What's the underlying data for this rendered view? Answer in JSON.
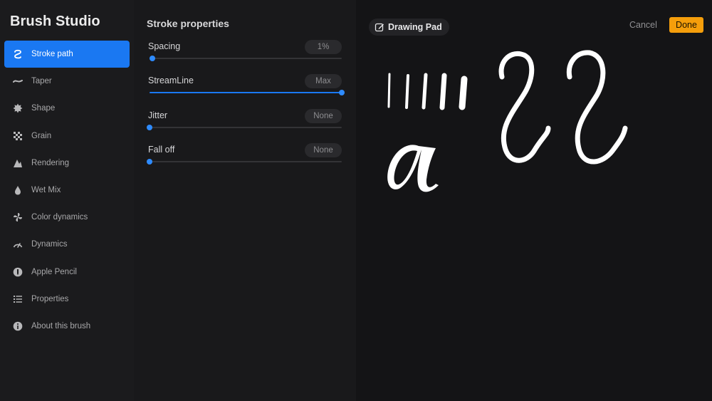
{
  "app": {
    "title": "Brush Studio"
  },
  "sidebar": {
    "items": [
      {
        "label": "Stroke path",
        "icon": "stroke-path-icon",
        "active": true
      },
      {
        "label": "Taper",
        "icon": "taper-icon"
      },
      {
        "label": "Shape",
        "icon": "shape-icon"
      },
      {
        "label": "Grain",
        "icon": "grain-icon"
      },
      {
        "label": "Rendering",
        "icon": "rendering-icon"
      },
      {
        "label": "Wet Mix",
        "icon": "wet-mix-icon"
      },
      {
        "label": "Color dynamics",
        "icon": "color-dynamics-icon"
      },
      {
        "label": "Dynamics",
        "icon": "dynamics-icon"
      },
      {
        "label": "Apple Pencil",
        "icon": "apple-pencil-icon"
      },
      {
        "label": "Properties",
        "icon": "properties-icon"
      },
      {
        "label": "About this brush",
        "icon": "info-icon"
      }
    ]
  },
  "panel": {
    "title": "Stroke properties",
    "settings": [
      {
        "label": "Spacing",
        "value": "1%",
        "level": 0.01
      },
      {
        "label": "StreamLine",
        "value": "Max",
        "level": 1.0
      },
      {
        "label": "Jitter",
        "value": "None",
        "level": 0.0
      },
      {
        "label": "Fall off",
        "value": "None",
        "level": 0.0
      }
    ]
  },
  "canvas": {
    "pad_label": "Drawing Pad",
    "cancel_label": "Cancel",
    "done_label": "Done"
  },
  "colors": {
    "accent": "#1a78f2",
    "done": "#f59e0b"
  }
}
